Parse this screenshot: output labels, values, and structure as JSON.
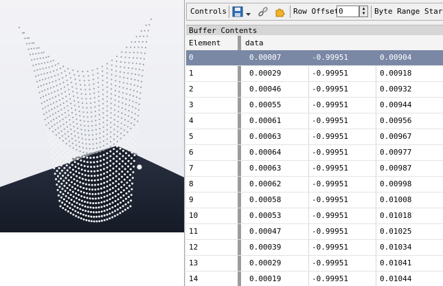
{
  "toolbar": {
    "controls_label": "Controls",
    "row_offset_label": "Row Offset",
    "row_offset_value": "0",
    "byte_range_label": "Byte Range Start",
    "save_icon": "save-icon",
    "link_icon": "link-icon",
    "puzzle_icon": "puzzle-icon"
  },
  "buffer": {
    "title": "Buffer Contents",
    "columns": [
      "Element",
      "data"
    ],
    "selected_row": 0,
    "rows": [
      {
        "element": "0",
        "x": "0.00007",
        "y": "-0.99951",
        "z": "0.00904"
      },
      {
        "element": "1",
        "x": "0.00029",
        "y": "-0.99951",
        "z": "0.00918"
      },
      {
        "element": "2",
        "x": "0.00046",
        "y": "-0.99951",
        "z": "0.00932"
      },
      {
        "element": "3",
        "x": "0.00055",
        "y": "-0.99951",
        "z": "0.00944"
      },
      {
        "element": "4",
        "x": "0.00061",
        "y": "-0.99951",
        "z": "0.00956"
      },
      {
        "element": "5",
        "x": "0.00063",
        "y": "-0.99951",
        "z": "0.00967"
      },
      {
        "element": "6",
        "x": "0.00064",
        "y": "-0.99951",
        "z": "0.00977"
      },
      {
        "element": "7",
        "x": "0.00063",
        "y": "-0.99951",
        "z": "0.00987"
      },
      {
        "element": "8",
        "x": "0.00062",
        "y": "-0.99951",
        "z": "0.00998"
      },
      {
        "element": "9",
        "x": "0.00058",
        "y": "-0.99951",
        "z": "0.01008"
      },
      {
        "element": "10",
        "x": "0.00053",
        "y": "-0.99951",
        "z": "0.01018"
      },
      {
        "element": "11",
        "x": "0.00047",
        "y": "-0.99951",
        "z": "0.01025"
      },
      {
        "element": "12",
        "x": "0.00039",
        "y": "-0.99951",
        "z": "0.01034"
      },
      {
        "element": "13",
        "x": "0.00029",
        "y": "-0.99951",
        "z": "0.01041"
      },
      {
        "element": "14",
        "x": "0.00019",
        "y": "-0.99951",
        "z": "0.01044"
      }
    ]
  },
  "colors": {
    "selected_row": "#7a88a6",
    "floor": "#1e2433",
    "particle": "#ffffff"
  }
}
